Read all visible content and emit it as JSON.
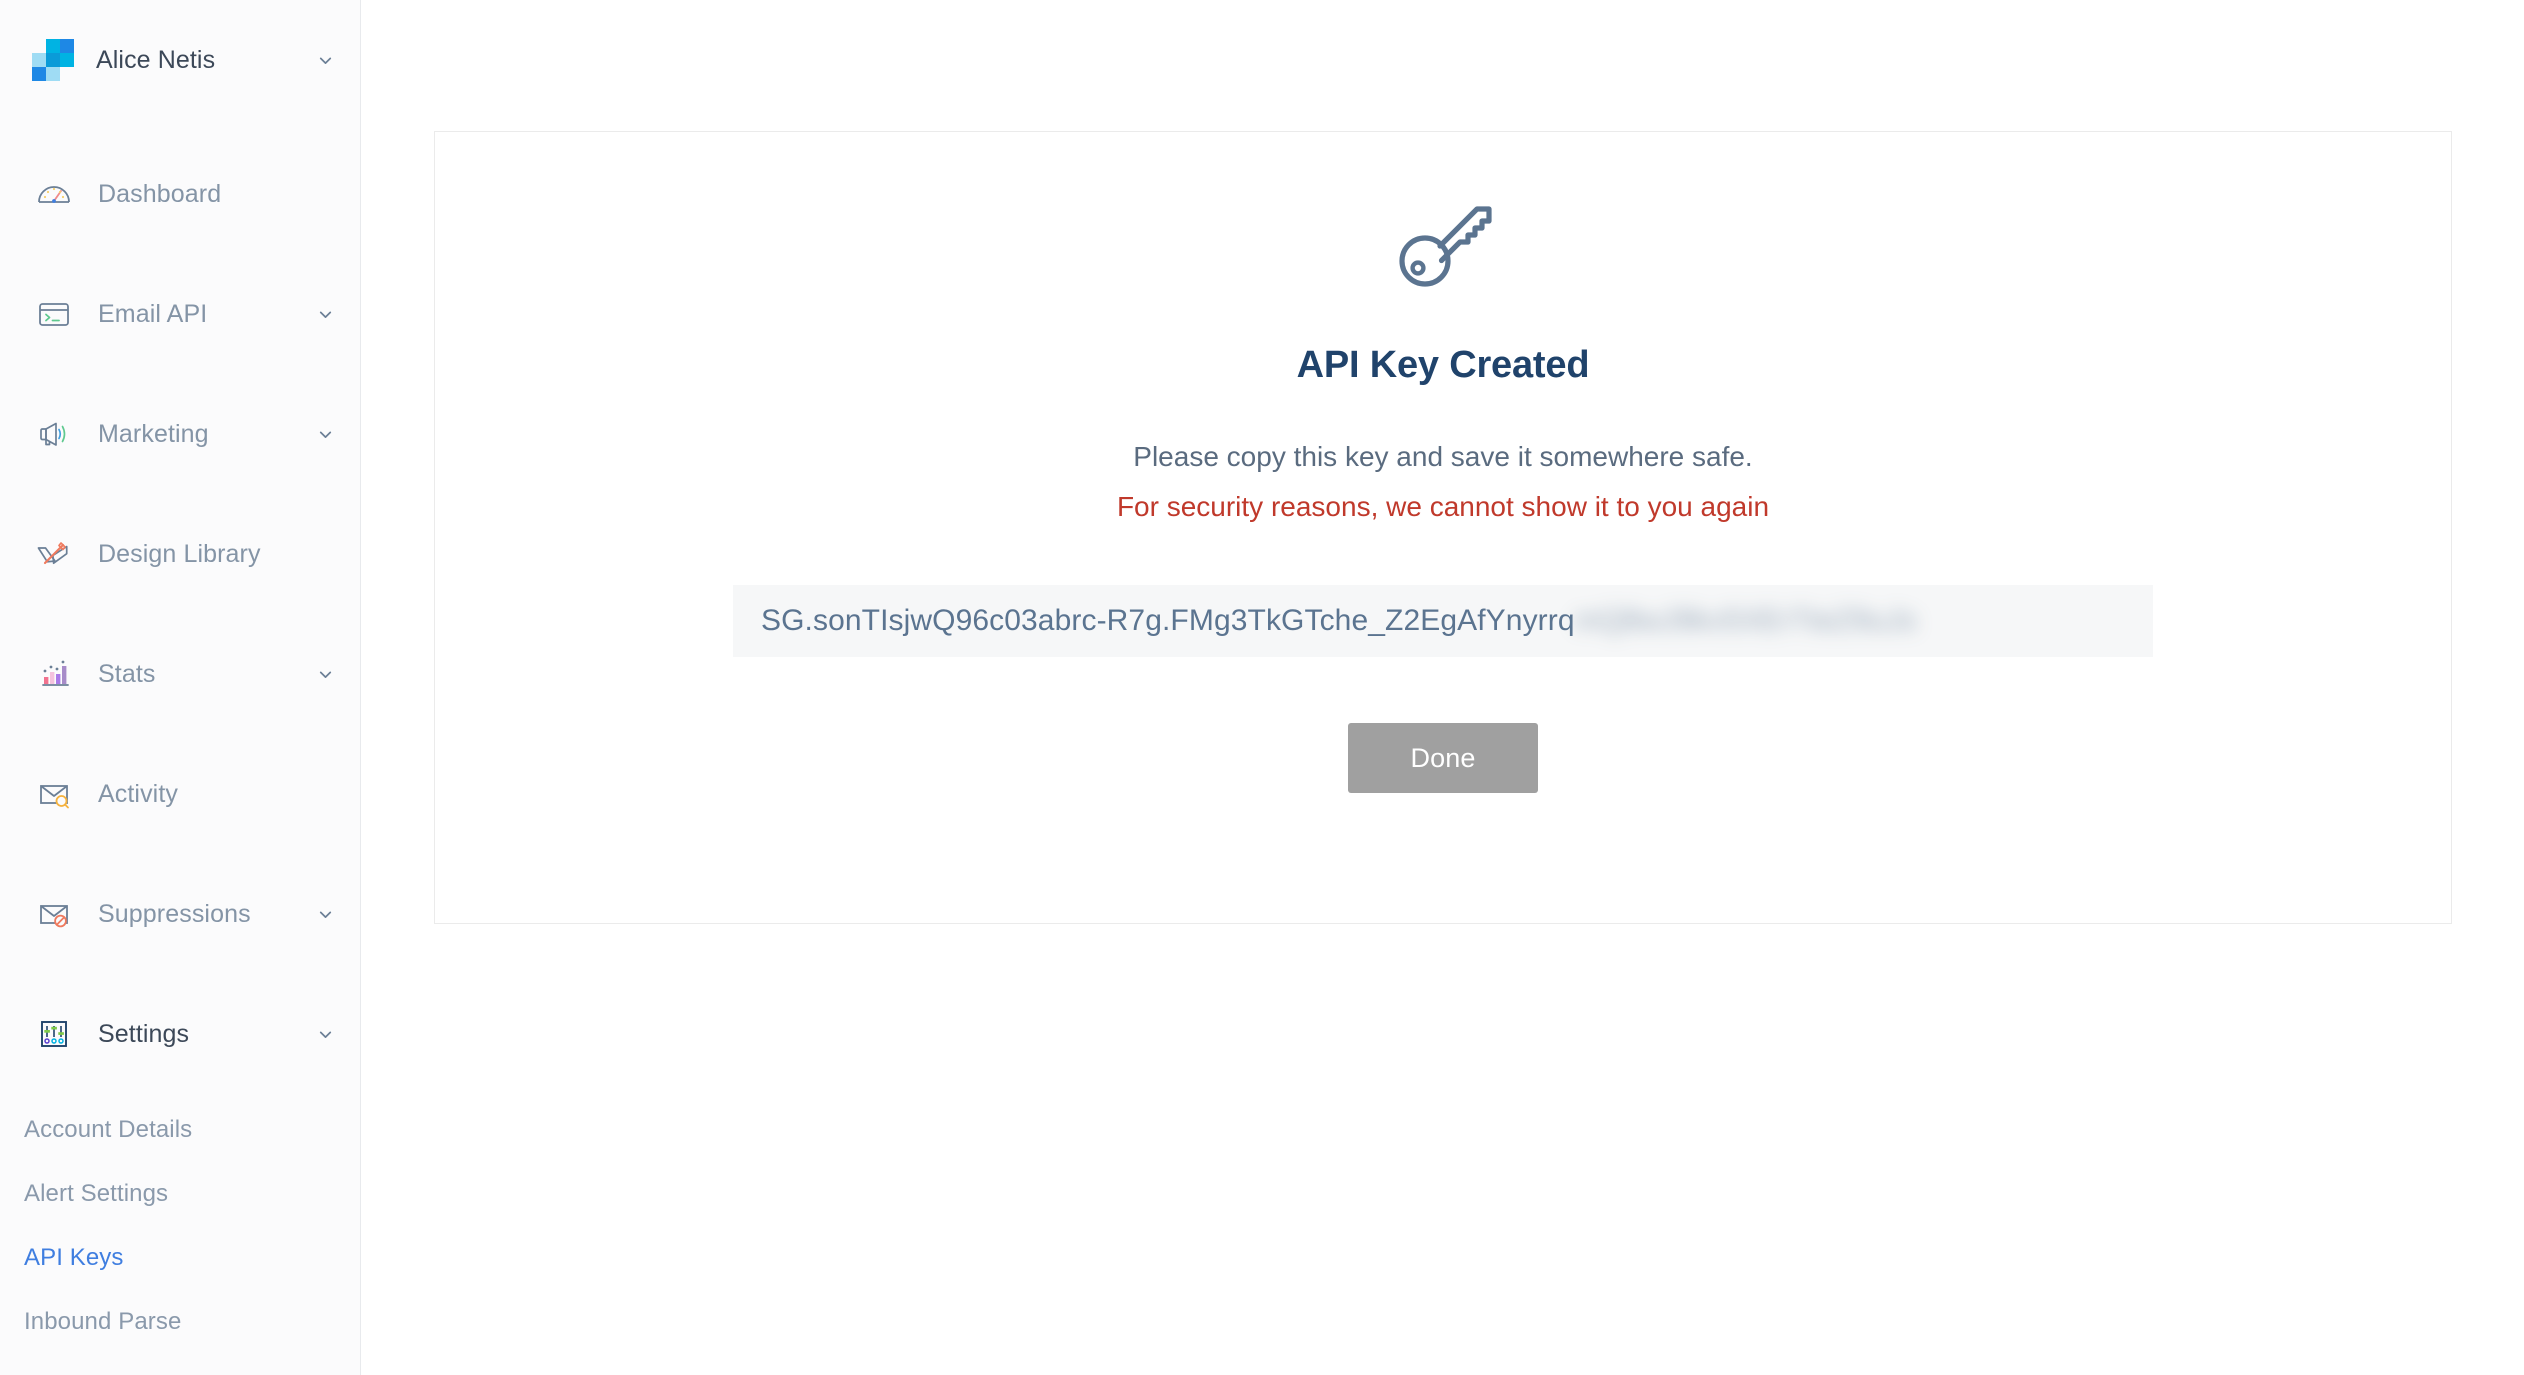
{
  "sidebar": {
    "brand": {
      "name": "Alice Netis",
      "chevron": "chevron-down-icon",
      "logo_colors": [
        "#00b3e3",
        "#1e88e5",
        "#9fdcf4",
        "#0a9bd8",
        "#00b3e3",
        "#1e88e5",
        "#9fdcf4"
      ]
    },
    "items": [
      {
        "label": "Dashboard",
        "icon": "gauge-icon",
        "expandable": false,
        "active": false
      },
      {
        "label": "Email API",
        "icon": "terminal-icon",
        "expandable": true,
        "active": false
      },
      {
        "label": "Marketing",
        "icon": "megaphone-icon",
        "expandable": true,
        "active": false
      },
      {
        "label": "Design Library",
        "icon": "pencil-ruler-icon",
        "expandable": false,
        "active": false
      },
      {
        "label": "Stats",
        "icon": "bar-chart-icon",
        "expandable": true,
        "active": false
      },
      {
        "label": "Activity",
        "icon": "envelope-search-icon",
        "expandable": false,
        "active": false
      },
      {
        "label": "Suppressions",
        "icon": "envelope-block-icon",
        "expandable": true,
        "active": false
      },
      {
        "label": "Settings",
        "icon": "sliders-icon",
        "expandable": true,
        "active": true
      }
    ],
    "settings_subitems": [
      {
        "label": "Account Details",
        "active": false
      },
      {
        "label": "Alert Settings",
        "active": false
      },
      {
        "label": "API Keys",
        "active": true
      },
      {
        "label": "Inbound Parse",
        "active": false
      }
    ],
    "active_color": "#3f7ee0"
  },
  "card": {
    "icon": "key-icon",
    "title": "API Key Created",
    "subtitle": "Please copy this key and save it somewhere safe.",
    "warning": "For security reasons, we cannot show it to you again",
    "warning_color": "#c0392b",
    "api_key_visible": "SG.sonTIsjwQ96c03abrc-R7g.FMg3TkGTche_Z2EgAfYnyrrq",
    "api_key_redacted": "mQ8wJ9kv5XErTteZ9uJs",
    "done_label": "Done",
    "done_color": "#a0a0a0"
  }
}
